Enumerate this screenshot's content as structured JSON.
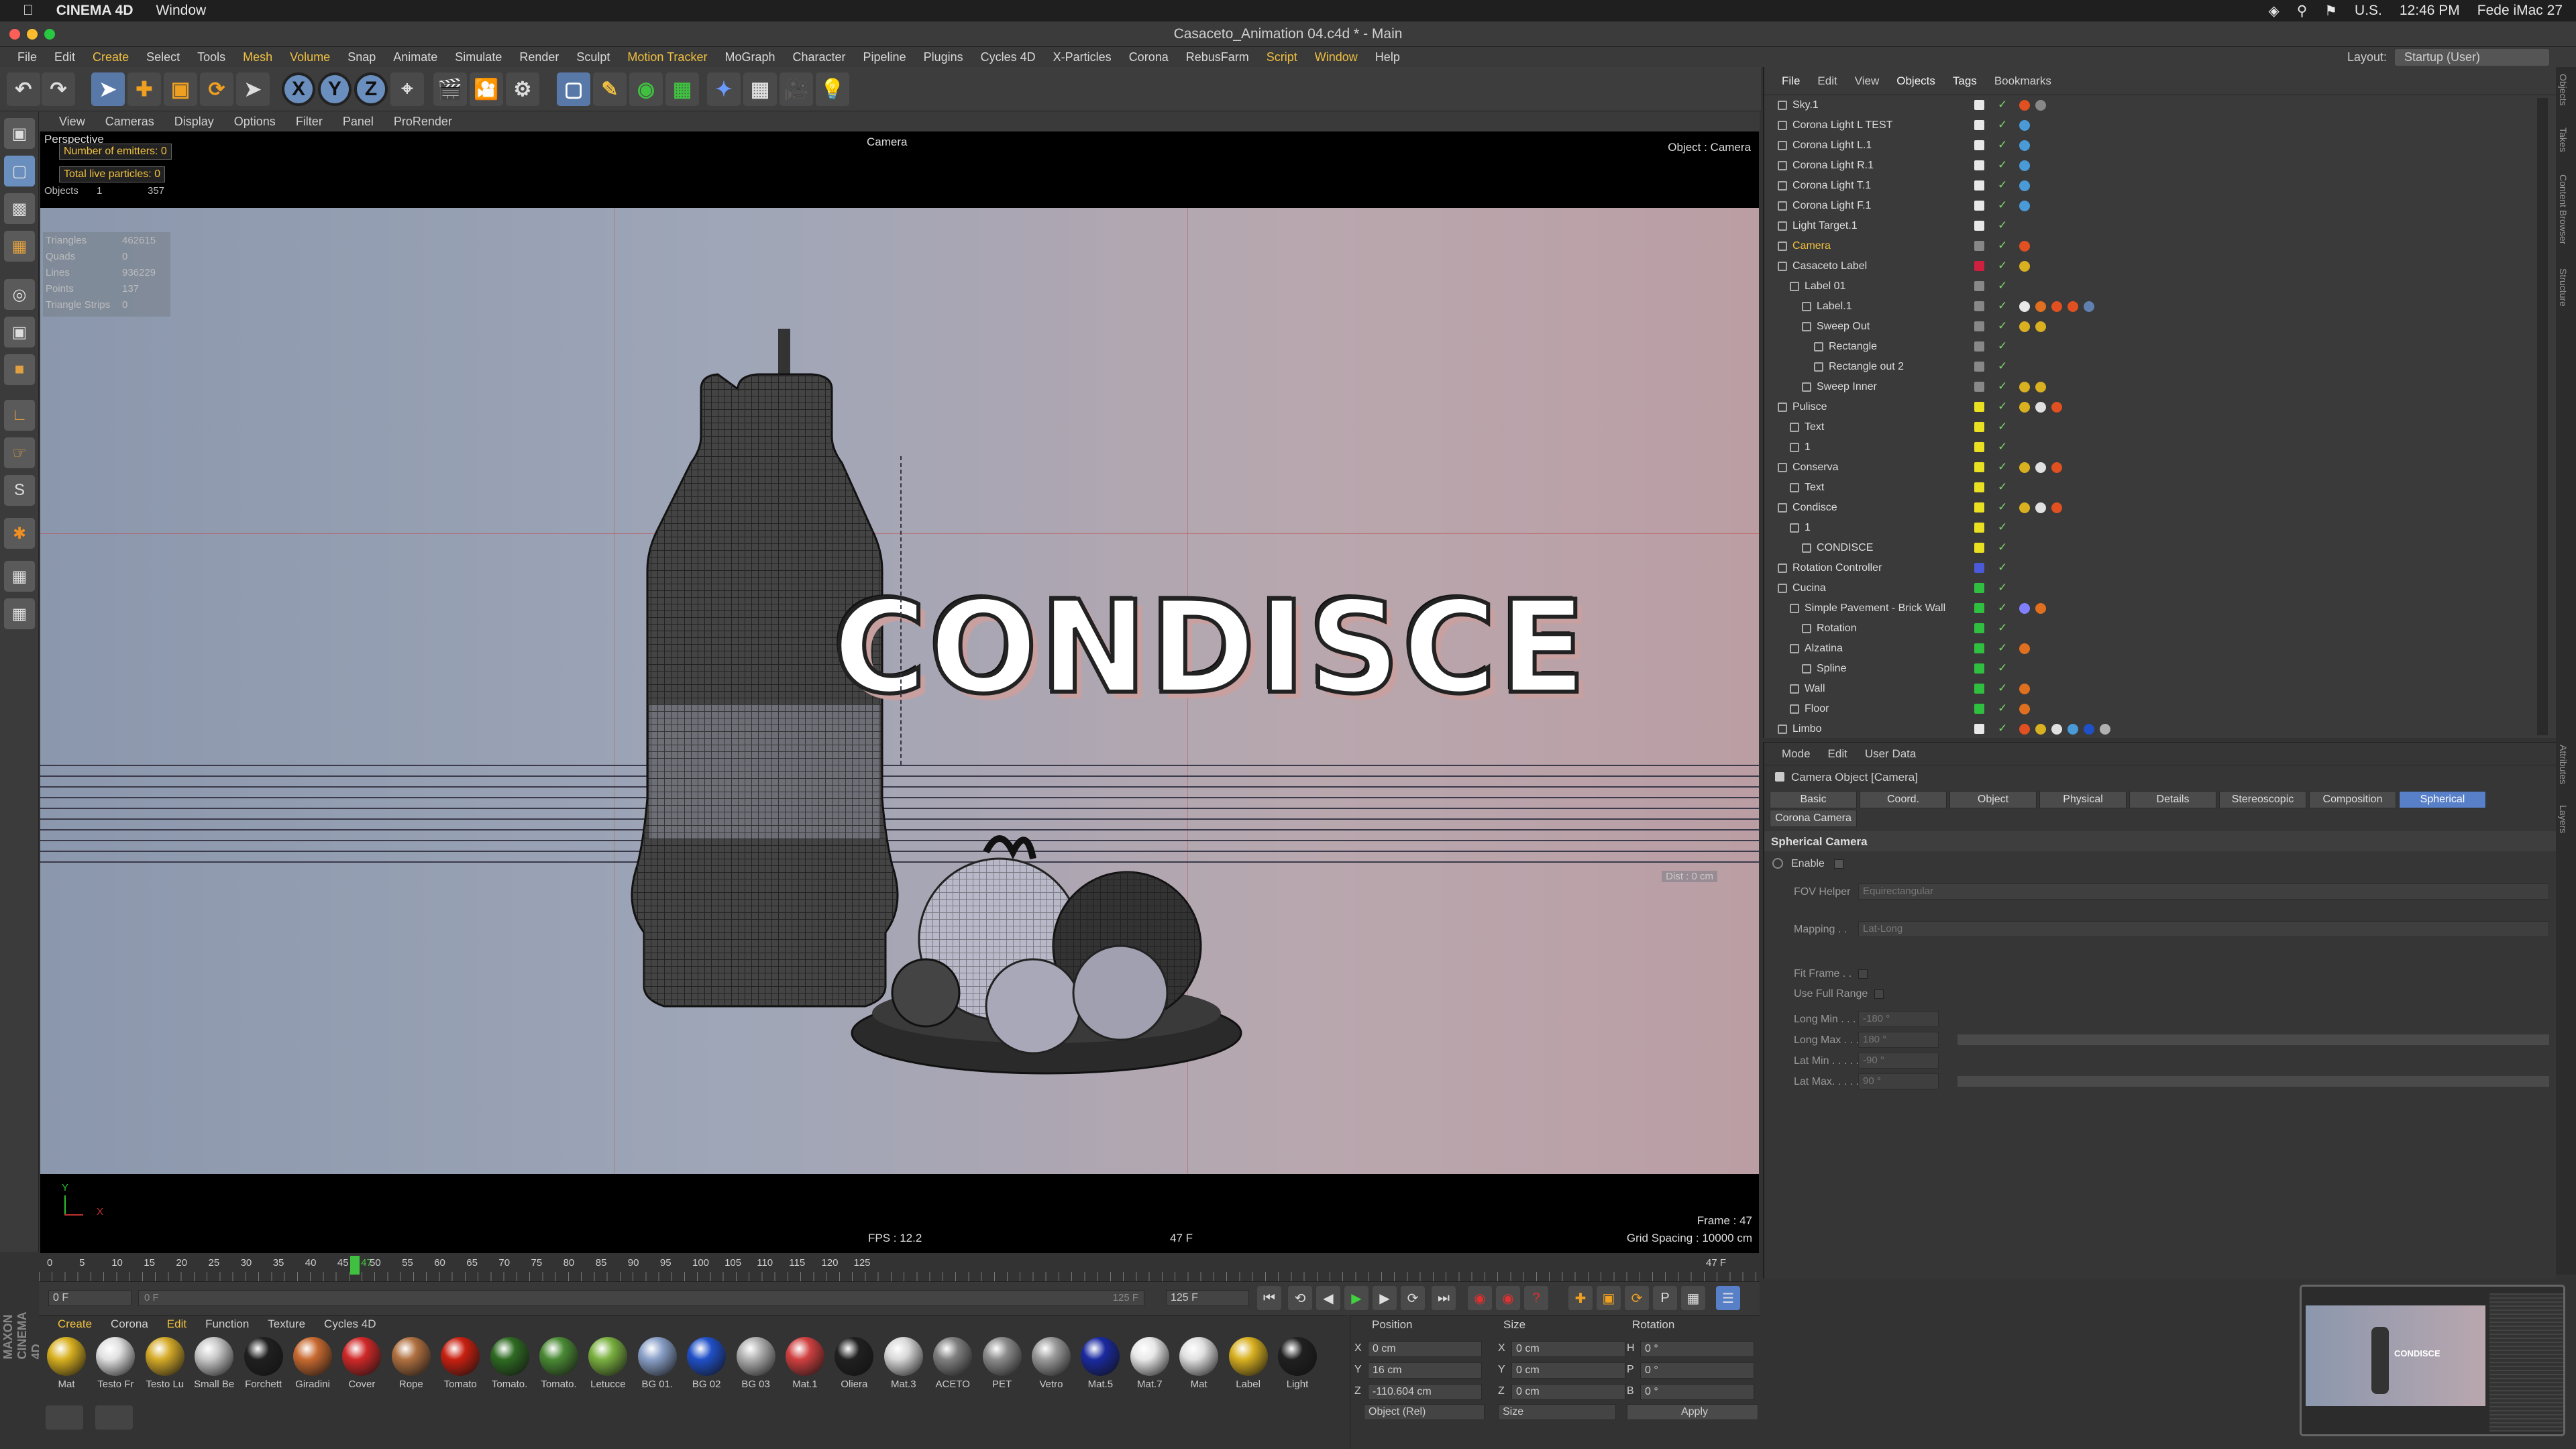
{
  "mac": {
    "app": "CINEMA 4D",
    "window": "Window",
    "lang": "U.S.",
    "time": "12:46 PM",
    "user": "Fede iMac 27"
  },
  "title": "Casaceto_Animation 04.c4d * - Main",
  "menu": [
    "File",
    "Edit",
    "Create",
    "Select",
    "Tools",
    "Mesh",
    "Volume",
    "Snap",
    "Animate",
    "Simulate",
    "Render",
    "Sculpt",
    "Motion Tracker",
    "MoGraph",
    "Character",
    "Pipeline",
    "Plugins",
    "Cycles 4D",
    "X-Particles",
    "Corona",
    "RebusFarm",
    "Script",
    "Window",
    "Help"
  ],
  "menu_highlight": [
    "Create",
    "Mesh",
    "Volume",
    "Motion Tracker",
    "Script",
    "Window"
  ],
  "layout": {
    "label": "Layout:",
    "value": "Startup (User)"
  },
  "toolbar": {
    "x": "X",
    "y": "Y",
    "z": "Z"
  },
  "viewport": {
    "menu": [
      "View",
      "Cameras",
      "Display",
      "Options",
      "Filter",
      "Panel",
      "ProRender"
    ],
    "perspective": "Perspective",
    "camera_label": "Camera",
    "object_label": "Object : Camera",
    "emitters": "Number of emitters: 0",
    "particles": "Total live particles: 0",
    "objects_label": "Objects",
    "objects_val": "1",
    "objects_num": "357",
    "stats": [
      [
        "Triangles",
        "462615"
      ],
      [
        "Quads",
        "0"
      ],
      [
        "Lines",
        "936229"
      ],
      [
        "Points",
        "137"
      ],
      [
        "Triangle Strips",
        "0"
      ]
    ],
    "dist": "Dist : 0 cm",
    "fps": "FPS : 12.2",
    "frame_mid": "47 F",
    "frame": "Frame : 47",
    "grid": "Grid Spacing : 10000 cm",
    "scene_text": "CONDISCE",
    "axis_y": "Y",
    "axis_x": "X"
  },
  "timeline": {
    "ticks": [
      "0",
      "5",
      "10",
      "15",
      "20",
      "25",
      "30",
      "35",
      "40",
      "45",
      "47",
      "50",
      "55",
      "60",
      "65",
      "70",
      "75",
      "80",
      "85",
      "90",
      "95",
      "100",
      "105",
      "110",
      "115",
      "120",
      "125"
    ],
    "current": 47,
    "end_label": "47 F",
    "start_field": "0 F",
    "range_start": "0 F",
    "range_end": "125 F",
    "end_field": "125 F"
  },
  "materials": {
    "menu": [
      "Create",
      "Corona",
      "Edit",
      "Function",
      "Texture",
      "Cycles 4D"
    ],
    "items": [
      [
        "Mat",
        "#d8b020"
      ],
      [
        "Testo Fr",
        "#e0e0e0"
      ],
      [
        "Testo Lu",
        "#d4aa28"
      ],
      [
        "Small Be",
        "#c8c8c8"
      ],
      [
        "Forchett",
        "#202020"
      ],
      [
        "Giradini",
        "#c86a30"
      ],
      [
        "Cover",
        "#d02828"
      ],
      [
        "Rope",
        "#b07040"
      ],
      [
        "Tomato",
        "#c82010"
      ],
      [
        "Tomato.",
        "#2e6a22"
      ],
      [
        "Tomato.",
        "#4a8a34"
      ],
      [
        "Letucce",
        "#7ab040"
      ],
      [
        "BG 01.",
        "#8aa0c8"
      ],
      [
        "BG 02",
        "#2050c8"
      ],
      [
        "BG 03",
        "#b0b0b0"
      ],
      [
        "Mat.1",
        "#d04040"
      ],
      [
        "Oliera",
        "#202020"
      ],
      [
        "Mat.3",
        "#d8d8d8"
      ],
      [
        "ACETO",
        "#808080"
      ],
      [
        "PET",
        "#8c8c8c"
      ],
      [
        "Vetro",
        "#9a9a9a"
      ],
      [
        "Mat.5",
        "#1a2aa0"
      ],
      [
        "Mat.7",
        "#e8e8e8"
      ],
      [
        "Mat",
        "#e0e0e0"
      ],
      [
        "Label",
        "#d8b020"
      ],
      [
        "Light",
        "#202020"
      ]
    ]
  },
  "coords": {
    "headers": [
      "Position",
      "Size",
      "Rotation"
    ],
    "rows": [
      [
        "X",
        "0 cm",
        "X",
        "0 cm",
        "H",
        "0 °"
      ],
      [
        "Y",
        "16 cm",
        "Y",
        "0 cm",
        "P",
        "0 °"
      ],
      [
        "Z",
        "-110.604 cm",
        "Z",
        "0 cm",
        "B",
        "0 °"
      ]
    ],
    "mode1": "Object (Rel)",
    "mode2": "Size",
    "apply": "Apply"
  },
  "objects": {
    "menu": [
      "File",
      "Edit",
      "View",
      "Objects",
      "Tags",
      "Bookmarks"
    ],
    "rows": [
      {
        "name": "Sky.1",
        "indent": 0,
        "color": "#e8e8e8",
        "tags": [
          "#e05020",
          "#888"
        ]
      },
      {
        "name": "Corona Light L TEST",
        "indent": 0,
        "color": "#e8e8e8",
        "tags": [
          "#4a9ad8"
        ]
      },
      {
        "name": "Corona Light L.1",
        "indent": 0,
        "color": "#e8e8e8",
        "tags": [
          "#4a9ad8"
        ]
      },
      {
        "name": "Corona Light R.1",
        "indent": 0,
        "color": "#e8e8e8",
        "tags": [
          "#4a9ad8"
        ]
      },
      {
        "name": "Corona Light T.1",
        "indent": 0,
        "color": "#e8e8e8",
        "tags": [
          "#4a9ad8"
        ]
      },
      {
        "name": "Corona Light F.1",
        "indent": 0,
        "color": "#e8e8e8",
        "tags": [
          "#4a9ad8"
        ]
      },
      {
        "name": "Light Target.1",
        "indent": 0,
        "color": "#e8e8e8",
        "tags": []
      },
      {
        "name": "Camera",
        "indent": 0,
        "color": "#888",
        "tags": [
          "#e05020"
        ],
        "hl": true
      },
      {
        "name": "Casaceto Label",
        "indent": 0,
        "color": "#d02040",
        "tags": [
          "#d8b020"
        ]
      },
      {
        "name": "Label 01",
        "indent": 1,
        "color": "#888",
        "tags": []
      },
      {
        "name": "Label.1",
        "indent": 2,
        "color": "#888",
        "tags": [
          "#e8e8e8",
          "#e07020",
          "#e05020",
          "#e05020",
          "#6080b0"
        ]
      },
      {
        "name": "Sweep Out",
        "indent": 2,
        "color": "#888",
        "tags": [
          "#d8b020",
          "#d8b020"
        ]
      },
      {
        "name": "Rectangle",
        "indent": 3,
        "color": "#888",
        "tags": []
      },
      {
        "name": "Rectangle out 2",
        "indent": 3,
        "color": "#888",
        "tags": []
      },
      {
        "name": "Sweep Inner",
        "indent": 2,
        "color": "#888",
        "tags": [
          "#d8b020",
          "#d8b020"
        ]
      },
      {
        "name": "Pulisce",
        "indent": 0,
        "color": "#e8e020",
        "tags": [
          "#d8b020",
          "#e0e0e0",
          "#e05020"
        ]
      },
      {
        "name": "Text",
        "indent": 1,
        "color": "#e8e020",
        "tags": []
      },
      {
        "name": "1",
        "indent": 1,
        "color": "#e8e020",
        "tags": []
      },
      {
        "name": "Conserva",
        "indent": 0,
        "color": "#e8e020",
        "tags": [
          "#d8b020",
          "#e0e0e0",
          "#e05020"
        ]
      },
      {
        "name": "Text",
        "indent": 1,
        "color": "#e8e020",
        "tags": []
      },
      {
        "name": "Condisce",
        "indent": 0,
        "color": "#e8e020",
        "tags": [
          "#d8b020",
          "#e0e0e0",
          "#e05020"
        ]
      },
      {
        "name": "1",
        "indent": 1,
        "color": "#e8e020",
        "tags": []
      },
      {
        "name": "CONDISCE",
        "indent": 2,
        "color": "#e8e020",
        "tags": []
      },
      {
        "name": "Rotation Controller",
        "indent": 0,
        "color": "#4a5ad8",
        "tags": []
      },
      {
        "name": "Cucina",
        "indent": 0,
        "color": "#30c040",
        "tags": []
      },
      {
        "name": "Simple Pavement - Brick Wall",
        "indent": 1,
        "color": "#30c040",
        "tags": [
          "#8080ff",
          "#e07020"
        ]
      },
      {
        "name": "Rotation",
        "indent": 2,
        "color": "#30c040",
        "tags": []
      },
      {
        "name": "Alzatina",
        "indent": 1,
        "color": "#30c040",
        "tags": [
          "#e07020"
        ]
      },
      {
        "name": "Spline",
        "indent": 2,
        "color": "#30c040",
        "tags": []
      },
      {
        "name": "Wall",
        "indent": 1,
        "color": "#30c040",
        "tags": [
          "#e07020"
        ]
      },
      {
        "name": "Floor",
        "indent": 1,
        "color": "#30c040",
        "tags": [
          "#e07020"
        ]
      },
      {
        "name": "Limbo",
        "indent": 0,
        "color": "#e8e8e8",
        "tags": [
          "#e05020",
          "#d8b020",
          "#e0e0e0",
          "#4a9ad8",
          "#2050c8",
          "#b0b0b0"
        ]
      }
    ]
  },
  "attributes": {
    "menu": [
      "Mode",
      "Edit",
      "User Data"
    ],
    "title": "Camera Object [Camera]",
    "tabs": [
      "Basic",
      "Coord.",
      "Object",
      "Physical",
      "Details",
      "Stereoscopic",
      "Composition",
      "Spherical"
    ],
    "active_tab": "Spherical",
    "tab2": "Corona Camera",
    "section": "Spherical Camera",
    "enable": "Enable",
    "fov_label": "FOV Helper",
    "fov_value": "Equirectangular",
    "mapping_label": "Mapping . .",
    "mapping_value": "Lat-Long",
    "fit_frame": "Fit Frame . .",
    "use_full": "Use Full Range",
    "fields": [
      [
        "Long Min . . . .",
        "-180 °"
      ],
      [
        "Long Max . . .",
        "180 °"
      ],
      [
        "Lat Min . . . . .",
        "-90 °"
      ],
      [
        "Lat Max. . . . .",
        "90 °"
      ]
    ]
  },
  "right_tabs": [
    "Objects",
    "Takes",
    "Content Browser",
    "Structure",
    "Attributes",
    "Layers"
  ],
  "maxon": "MAXON CINEMA 4D"
}
